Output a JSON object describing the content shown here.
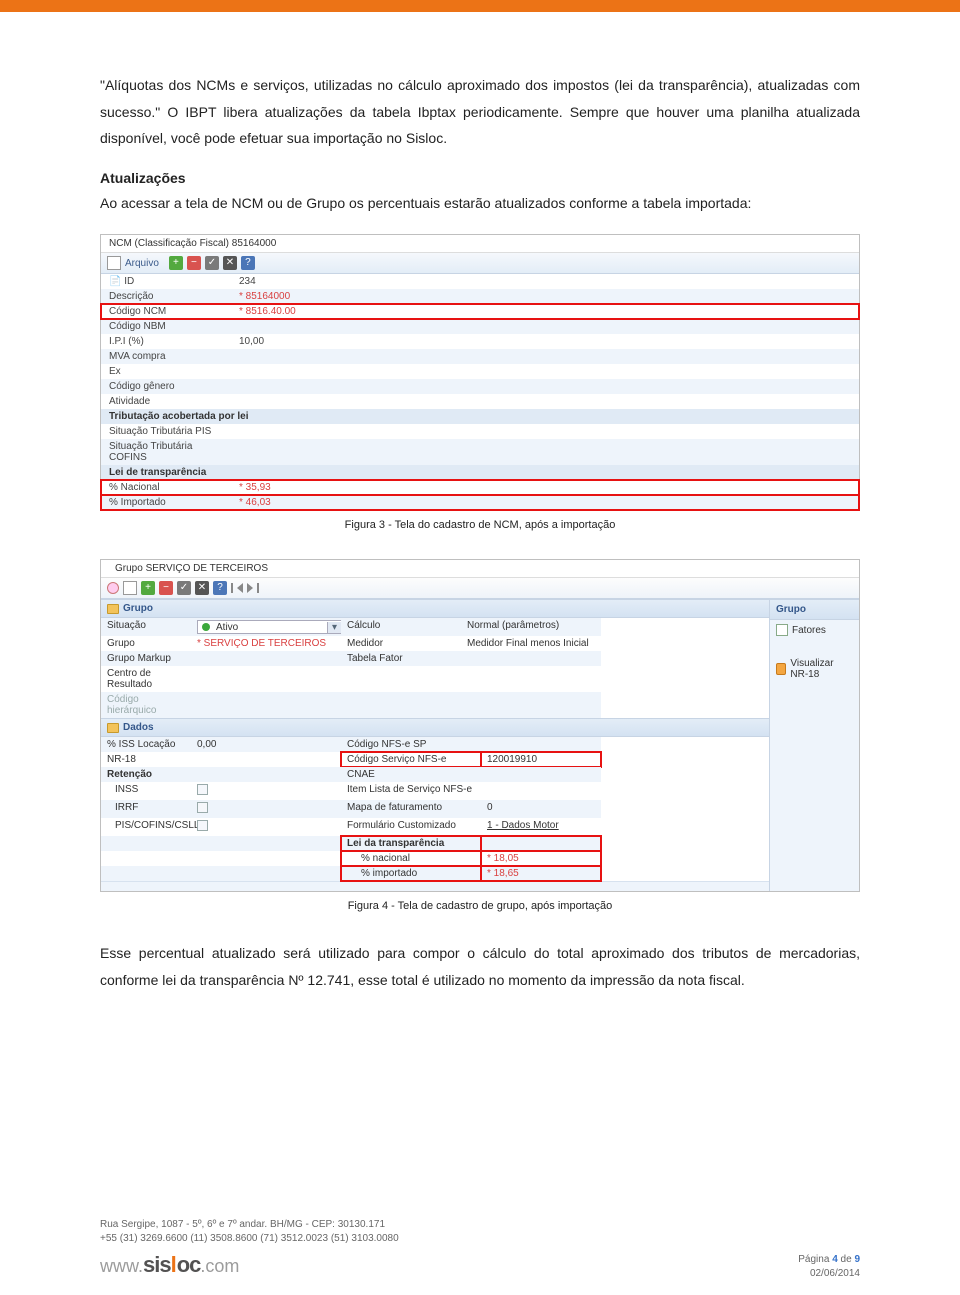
{
  "body": {
    "para1": "\"Alíquotas dos NCMs e serviços, utilizadas no cálculo aproximado dos impostos (lei da transparência), atualizadas com sucesso.\" O IBPT libera atualizações da tabela Ibptax periodicamente. Sempre que houver uma planilha atualizada disponível, você pode efetuar sua importação no Sisloc.",
    "heading1": "Atualizações",
    "para2": "Ao acessar a tela de NCM ou de Grupo os percentuais estarão atualizados conforme a tabela importada:",
    "caption1": "Figura 3 - Tela do cadastro de NCM, após a importação",
    "caption2": "Figura 4 - Tela de cadastro de grupo, após importação",
    "para3": "Esse percentual atualizado será utilizado para compor o cálculo do total aproximado dos tributos de mercadorias, conforme lei da transparência Nº 12.741, esse total é utilizado no momento da impressão da nota fiscal."
  },
  "shot1": {
    "title": "NCM (Classificação Fiscal) 85164000",
    "toolbar_label": "Arquivo",
    "rows": {
      "id_lbl": "ID",
      "id_val": "234",
      "desc_lbl": "Descrição",
      "desc_val": "* 85164000",
      "codncm_lbl": "Código NCM",
      "codncm_val": "* 8516.40.00",
      "codnbm_lbl": "Código NBM",
      "ipi_lbl": "I.P.I (%)",
      "ipi_val": "10,00",
      "mva_lbl": "MVA compra",
      "ex_lbl": "Ex",
      "codgen_lbl": "Código gênero",
      "atv_lbl": "Atividade",
      "trib_header": "Tributação acobertada por lei",
      "sitpis_lbl": "Situação Tributária PIS",
      "sitcof_lbl": "Situação Tributária COFINS",
      "lei_header": "Lei de transparência",
      "nac_lbl": "% Nacional",
      "nac_val": "* 35,93",
      "imp_lbl": "% Importado",
      "imp_val": "* 46,03"
    }
  },
  "shot2": {
    "title": "Grupo SERVIÇO DE TERCEIROS",
    "panel_grupo": "Grupo",
    "panel_dados": "Dados",
    "left": {
      "situacao_lbl": "Situação",
      "situacao_val": "Ativo",
      "grupo_lbl": "Grupo",
      "grupo_val": "* SERVIÇO DE TERCEIROS",
      "markup_lbl": "Grupo Markup",
      "centro_lbl": "Centro de Resultado",
      "codhier_lbl": "Código hierárquico",
      "calc_lbl": "Cálculo",
      "calc_val": "Normal (parâmetros)",
      "medidor_lbl": "Medidor",
      "medidor_val": "Medidor Final menos Inicial",
      "tabfator_lbl": "Tabela Fator",
      "iss_lbl": "% ISS Locação",
      "iss_val": "0,00",
      "nr18_lbl": "NR-18",
      "ret_lbl": "Retenção",
      "inss_lbl": "INSS",
      "irrf_lbl": "IRRF",
      "pis_lbl": "PIS/COFINS/CSLL",
      "codsp_lbl": "Código NFS-e SP",
      "codserv_lbl": "Código Serviço NFS-e",
      "codserv_val": "120019910",
      "cnae_lbl": "CNAE",
      "itemlista_lbl": "Item Lista de Serviço NFS-e",
      "mapa_lbl": "Mapa de faturamento",
      "mapa_val": "0",
      "form_lbl": "Formulário Customizado",
      "form_val": "1 - Dados Motor",
      "leida_lbl": "Lei da transparência",
      "pctnac_lbl": "% nacional",
      "pctnac_val": "* 18,05",
      "pctimp_lbl": "% importado",
      "pctimp_val": "* 18,65"
    },
    "side": {
      "grupo_head": "Grupo",
      "fatores": "Fatores",
      "visualizar": "Visualizar NR-18"
    }
  },
  "footer": {
    "addr1": "Rua Sergipe, 1087 - 5º, 6º e 7º andar. BH/MG - CEP: 30130.171",
    "addr2": "+55 (31) 3269.6600  (11) 3508.8600  (71) 3512.0023  (51) 3103.0080",
    "brand_www": "www.",
    "brand_name": "sisloc",
    "brand_com": ".com",
    "page_label": "Página ",
    "page_cur": "4",
    "page_of": " de ",
    "page_total": "9",
    "date": "02/06/2014"
  }
}
